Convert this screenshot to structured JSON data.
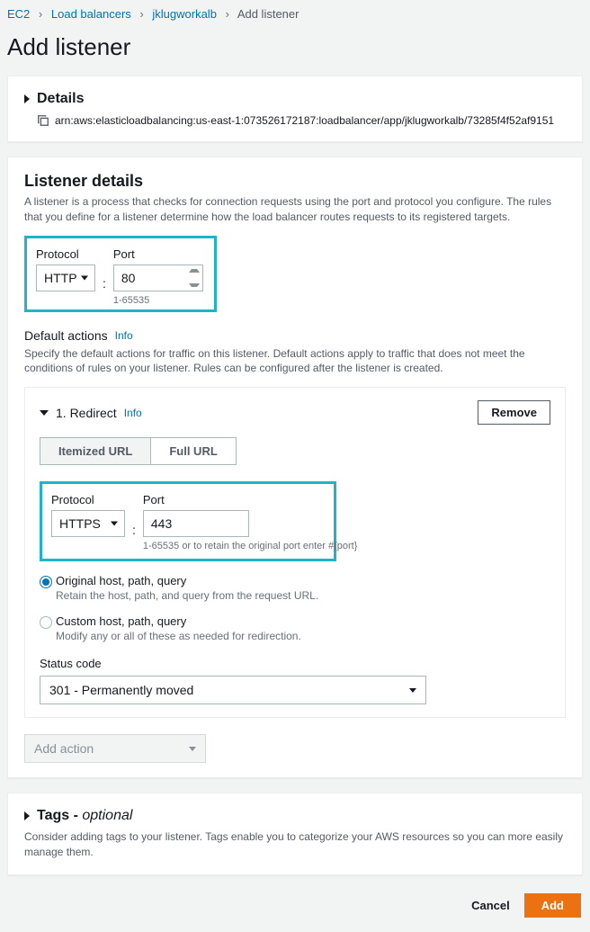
{
  "breadcrumb": {
    "items": [
      "EC2",
      "Load balancers",
      "jklugworkalb",
      "Add listener"
    ]
  },
  "page_title": "Add listener",
  "details": {
    "title": "Details",
    "arn": "arn:aws:elasticloadbalancing:us-east-1:073526172187:loadbalancer/app/jklugworkalb/73285f4f52af9151"
  },
  "listener": {
    "title": "Listener details",
    "description": "A listener is a process that checks for connection requests using the port and protocol you configure. The rules that you define for a listener determine how the load balancer routes requests to its registered targets.",
    "protocol_label": "Protocol",
    "protocol_value": "HTTP",
    "port_label": "Port",
    "port_value": "80",
    "port_help": "1-65535"
  },
  "default_actions": {
    "title": "Default actions",
    "info": "Info",
    "description": "Specify the default actions for traffic on this listener. Default actions apply to traffic that does not meet the conditions of rules on your listener. Rules can be configured after the listener is created."
  },
  "redirect": {
    "title": "1. Redirect",
    "info": "Info",
    "remove": "Remove",
    "tabs": {
      "itemized": "Itemized URL",
      "full": "Full URL"
    },
    "protocol_label": "Protocol",
    "protocol_value": "HTTPS",
    "port_label": "Port",
    "port_value": "443",
    "port_help": "1-65535 or to retain the original port enter #{port}",
    "options": {
      "original": {
        "label": "Original host, path, query",
        "desc": "Retain the host, path, and query from the request URL."
      },
      "custom": {
        "label": "Custom host, path, query",
        "desc": "Modify any or all of these as needed for redirection."
      }
    },
    "status_label": "Status code",
    "status_value": "301 - Permanently moved"
  },
  "add_action": "Add action",
  "tags": {
    "title": "Tags - ",
    "optional": "optional",
    "description": "Consider adding tags to your listener. Tags enable you to categorize your AWS resources so you can more easily manage them."
  },
  "footer": {
    "cancel": "Cancel",
    "add": "Add"
  }
}
